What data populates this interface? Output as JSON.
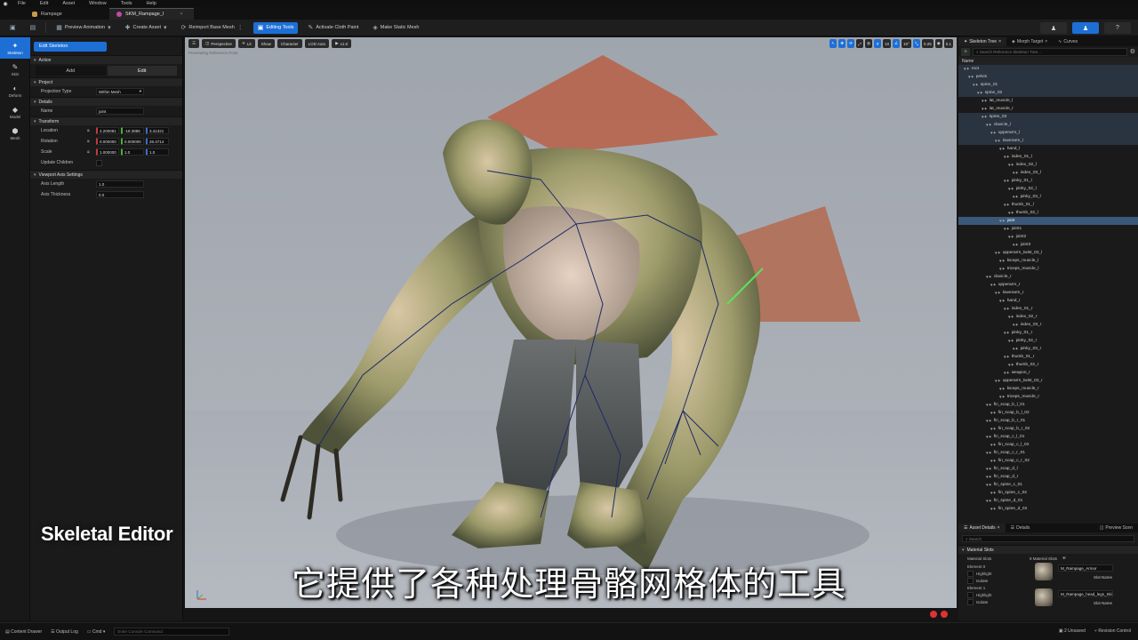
{
  "menu": [
    "File",
    "Edit",
    "Asset",
    "Window",
    "Tools",
    "Help"
  ],
  "tabs": [
    {
      "label": "Rampage",
      "active": false
    },
    {
      "label": "SKM_Rampage_I",
      "active": true
    }
  ],
  "toolbar": {
    "preview_animation": "Preview Animation",
    "create_asset": "Create Asset",
    "reimport": "Reimport Base Mesh",
    "editing_tools": "Editing Tools",
    "cloth_paint": "Activate Cloth Paint",
    "make_static": "Make Static Mesh"
  },
  "modes": [
    "Skeleton",
    "Skin",
    "Deform",
    "Model",
    "Mesh"
  ],
  "left_panel": {
    "edit_skeleton": "Edit Skeleton",
    "action_section": "Action",
    "add": "Add",
    "edit": "Edit",
    "project_section": "Project",
    "projection_type_label": "Projection Type",
    "projection_type_value": "Within Mesh",
    "details_section": "Details",
    "name_label": "Name",
    "name_value": "joint",
    "transform_section": "Transform",
    "location_label": "Location",
    "location": [
      "4.200081",
      "-18.3886",
      "3.41321"
    ],
    "rotation_label": "Rotation",
    "rotation": [
      "0.000000",
      "0.000000",
      "26.4714"
    ],
    "scale_label": "Scale",
    "scale": [
      "1.000000",
      "1.0",
      "1.0"
    ],
    "update_children_label": "Update Children",
    "viewport_section": "Viewport Axis Settings",
    "axis_length_label": "Axis Length",
    "axis_length": "1.0",
    "axis_thickness_label": "Axis Thickness",
    "axis_thickness": "0.0"
  },
  "viewport": {
    "perspective": "Perspective",
    "lit": "Lit",
    "show": "Show",
    "character": "Character",
    "lod": "LOD Auto",
    "speed": "x1.0",
    "info": "Previewing Reference Pose",
    "fov": "10",
    "snap": "10°",
    "scale_snap": "0.25",
    "cam_speed": "0.1"
  },
  "right_panel": {
    "tabs": [
      "Skeleton Tree",
      "Morph Target",
      "Curves"
    ],
    "search_placeholder": "Search Reference Skeleton Tree...",
    "column": "Name",
    "bones": [
      {
        "n": "root",
        "d": 0,
        "s": "hl"
      },
      {
        "n": "pelvis",
        "d": 1,
        "s": "hl"
      },
      {
        "n": "spine_01",
        "d": 2,
        "s": "hl"
      },
      {
        "n": "spine_02",
        "d": 3,
        "s": "hl"
      },
      {
        "n": "lat_muscle_l",
        "d": 4,
        "s": ""
      },
      {
        "n": "lat_muscle_r",
        "d": 4,
        "s": ""
      },
      {
        "n": "spine_03",
        "d": 4,
        "s": "hl"
      },
      {
        "n": "clavicle_l",
        "d": 5,
        "s": "hl"
      },
      {
        "n": "upperarm_l",
        "d": 6,
        "s": "hl"
      },
      {
        "n": "lowerarm_l",
        "d": 7,
        "s": "hl"
      },
      {
        "n": "hand_l",
        "d": 8,
        "s": ""
      },
      {
        "n": "index_01_l",
        "d": 9,
        "s": ""
      },
      {
        "n": "index_02_l",
        "d": 10,
        "s": ""
      },
      {
        "n": "index_03_l",
        "d": 11,
        "s": ""
      },
      {
        "n": "pinky_01_l",
        "d": 9,
        "s": ""
      },
      {
        "n": "pinky_02_l",
        "d": 10,
        "s": ""
      },
      {
        "n": "pinky_03_l",
        "d": 11,
        "s": ""
      },
      {
        "n": "thumb_01_l",
        "d": 9,
        "s": ""
      },
      {
        "n": "thumb_02_l",
        "d": 10,
        "s": ""
      },
      {
        "n": "joint",
        "d": 8,
        "s": "sel"
      },
      {
        "n": "joint1",
        "d": 9,
        "s": ""
      },
      {
        "n": "joint2",
        "d": 10,
        "s": ""
      },
      {
        "n": "joint3",
        "d": 11,
        "s": ""
      },
      {
        "n": "upperarm_twist_02_l",
        "d": 7,
        "s": ""
      },
      {
        "n": "biceps_muscle_l",
        "d": 8,
        "s": ""
      },
      {
        "n": "triceps_muscle_l",
        "d": 8,
        "s": ""
      },
      {
        "n": "clavicle_r",
        "d": 5,
        "s": ""
      },
      {
        "n": "upperarm_r",
        "d": 6,
        "s": ""
      },
      {
        "n": "lowerarm_r",
        "d": 7,
        "s": ""
      },
      {
        "n": "hand_r",
        "d": 8,
        "s": ""
      },
      {
        "n": "index_01_r",
        "d": 9,
        "s": ""
      },
      {
        "n": "index_02_r",
        "d": 10,
        "s": ""
      },
      {
        "n": "index_03_r",
        "d": 11,
        "s": ""
      },
      {
        "n": "pinky_01_r",
        "d": 9,
        "s": ""
      },
      {
        "n": "pinky_02_r",
        "d": 10,
        "s": ""
      },
      {
        "n": "pinky_03_r",
        "d": 11,
        "s": ""
      },
      {
        "n": "thumb_01_r",
        "d": 9,
        "s": ""
      },
      {
        "n": "thumb_02_r",
        "d": 10,
        "s": ""
      },
      {
        "n": "weapon_r",
        "d": 9,
        "s": ""
      },
      {
        "n": "upperarm_twist_02_r",
        "d": 7,
        "s": ""
      },
      {
        "n": "biceps_muscle_r",
        "d": 8,
        "s": ""
      },
      {
        "n": "triceps_muscle_r",
        "d": 8,
        "s": ""
      },
      {
        "n": "fin_scap_b_l_01",
        "d": 5,
        "s": ""
      },
      {
        "n": "fin_scap_b_l_02",
        "d": 6,
        "s": ""
      },
      {
        "n": "fin_scap_b_r_01",
        "d": 5,
        "s": ""
      },
      {
        "n": "fin_scap_b_r_02",
        "d": 6,
        "s": ""
      },
      {
        "n": "fin_scap_c_l_01",
        "d": 5,
        "s": ""
      },
      {
        "n": "fin_scap_c_l_02",
        "d": 6,
        "s": ""
      },
      {
        "n": "fin_scap_c_r_01",
        "d": 5,
        "s": ""
      },
      {
        "n": "fin_scap_c_r_02",
        "d": 6,
        "s": ""
      },
      {
        "n": "fin_scap_d_l",
        "d": 5,
        "s": ""
      },
      {
        "n": "fin_scap_d_r",
        "d": 5,
        "s": ""
      },
      {
        "n": "fin_spine_c_01",
        "d": 5,
        "s": ""
      },
      {
        "n": "fin_spine_c_02",
        "d": 6,
        "s": ""
      },
      {
        "n": "fin_spine_d_01",
        "d": 5,
        "s": ""
      },
      {
        "n": "fin_spine_d_02",
        "d": 6,
        "s": ""
      }
    ],
    "detail_tabs": [
      "Asset Details",
      "Details",
      "Preview Scen"
    ],
    "detail_search": "Search",
    "material_slots_section": "Material Slots",
    "material_slots_label": "Material Slots",
    "material_slots_count": "9 Material Slots",
    "element0": "Element 0",
    "element1": "Element 1",
    "highlight": "Highlight",
    "isolate": "Isolate",
    "mat0": "M_Rampage_Armor",
    "mat1": "M_Rampage_head_legs_Skin_Ir",
    "slot_name": "Slot Name"
  },
  "status": {
    "content_drawer": "Content Drawer",
    "output_log": "Output Log",
    "cmd": "Cmd",
    "console_placeholder": "Enter Console Command",
    "unsaved": "2 Unsaved",
    "revision": "Revision Control"
  },
  "overlay": {
    "title": "Skeletal Editor",
    "subtitle": "它提供了各种处理骨骼网格体的工具"
  }
}
